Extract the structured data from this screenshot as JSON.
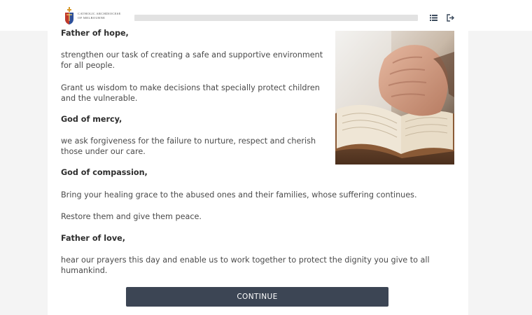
{
  "header": {
    "logo_text": [
      "CATHOLIC ARCHDIOCESE",
      "OF MELBOURNE"
    ],
    "progress": 0.0,
    "menu_icon": "list-menu-icon",
    "exit_icon": "exit-icon"
  },
  "prayer": {
    "lines": [
      {
        "type": "heading",
        "text": "Father of hope,"
      },
      {
        "type": "body",
        "text": "strengthen our task of creating a safe and supportive environment for all people."
      },
      {
        "type": "body",
        "text": "Grant us wisdom to make decisions that specially protect children and the vulnerable."
      },
      {
        "type": "heading",
        "text": "God of mercy,"
      },
      {
        "type": "body",
        "text": "we ask forgiveness for the failure to nurture, respect and cherish those under our care."
      },
      {
        "type": "heading",
        "text": "God of compassion,"
      },
      {
        "type": "body",
        "text": "Bring your healing grace to the abused ones and their families, whose suffering continues."
      },
      {
        "type": "body",
        "text": "Restore them and give them peace."
      },
      {
        "type": "heading",
        "text": "Father of love,"
      },
      {
        "type": "body",
        "text": "hear our prayers this day and enable us to work together to protect the dignity you give to all humankind."
      }
    ]
  },
  "continue_button": {
    "label": "CONTINUE"
  },
  "colors": {
    "button_bg": "#3c4554",
    "text": "#4a4a4a",
    "side_panel": "#f4f4f4"
  }
}
